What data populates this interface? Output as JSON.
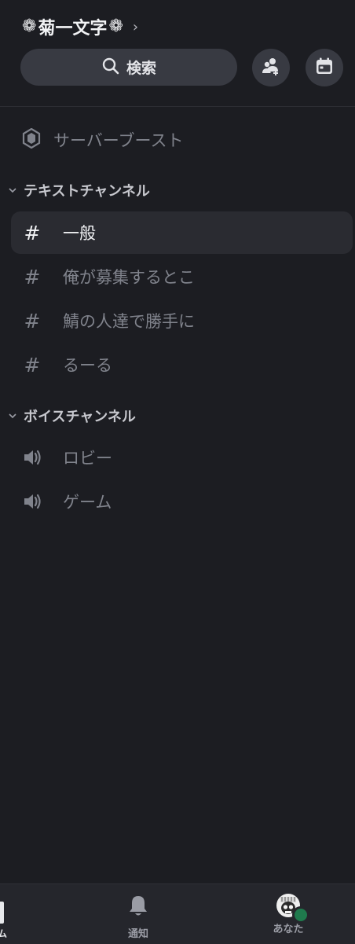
{
  "server": {
    "name": "菊一文字",
    "flower_glyph": "❁"
  },
  "search": {
    "label": "検索"
  },
  "header_buttons": {
    "invite_icon": "add-member-icon",
    "events_icon": "calendar-icon"
  },
  "boost": {
    "label": "サーバーブースト",
    "icon": "boost-gem-icon"
  },
  "categories": {
    "text": {
      "label": "テキストチャンネル"
    },
    "voice": {
      "label": "ボイスチャンネル"
    }
  },
  "text_channels": [
    {
      "label": "一般",
      "active": true
    },
    {
      "label": "俺が募集するとこ",
      "active": false
    },
    {
      "label": "鯖の人達で勝手に",
      "active": false
    },
    {
      "label": "るーる",
      "active": false
    }
  ],
  "voice_channels": [
    {
      "label": "ロビー"
    },
    {
      "label": "ゲーム"
    }
  ],
  "bottom_nav": {
    "home_partial": "ム",
    "notifications": "通知",
    "you": "あなた"
  },
  "colors": {
    "background": "#1c1d22",
    "search_bg": "#383a42",
    "active_row": "#2a2b31",
    "status_online": "#1f7a4d"
  }
}
